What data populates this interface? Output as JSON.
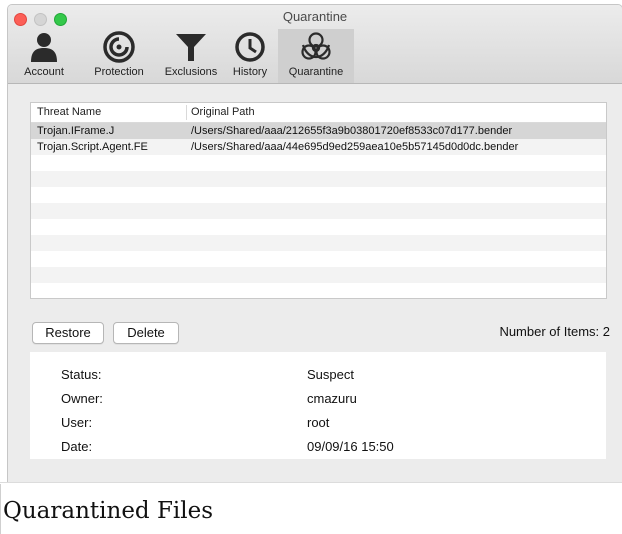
{
  "window": {
    "title": "Quarantine"
  },
  "toolbar": {
    "items": [
      {
        "label": "Account",
        "icon": "account-icon"
      },
      {
        "label": "Protection",
        "icon": "protection-icon"
      },
      {
        "label": "Exclusions",
        "icon": "funnel-icon"
      },
      {
        "label": "History",
        "icon": "clock-icon"
      },
      {
        "label": "Quarantine",
        "icon": "biohazard-icon",
        "selected": true
      }
    ]
  },
  "table": {
    "headers": [
      "Threat Name",
      "Original Path"
    ],
    "rows": [
      {
        "threat": "Trojan.IFrame.J",
        "path": "/Users/Shared/aaa/212655f3a9b03801720ef8533c07d177.bender",
        "selected": true
      },
      {
        "threat": "Trojan.Script.Agent.FE",
        "path": "/Users/Shared/aaa/44e695d9ed259aea10e5b57145d0d0dc.bender",
        "selected": false
      }
    ]
  },
  "actions": {
    "restore": "Restore",
    "delete": "Delete"
  },
  "count": {
    "label": "Number of Items:",
    "value": "2"
  },
  "details": [
    {
      "label": "Status:",
      "value": "Suspect"
    },
    {
      "label": "Owner:",
      "value": "cmazuru"
    },
    {
      "label": "User:",
      "value": "root"
    },
    {
      "label": "Date:",
      "value": "09/09/16 15:50"
    }
  ],
  "caption": "Quarantined Files",
  "colors": {
    "selected_toolbar": "#cfcfcf",
    "selected_row": "#d6d6d6",
    "close": "#fc5f57",
    "zoom": "#34c84a"
  }
}
